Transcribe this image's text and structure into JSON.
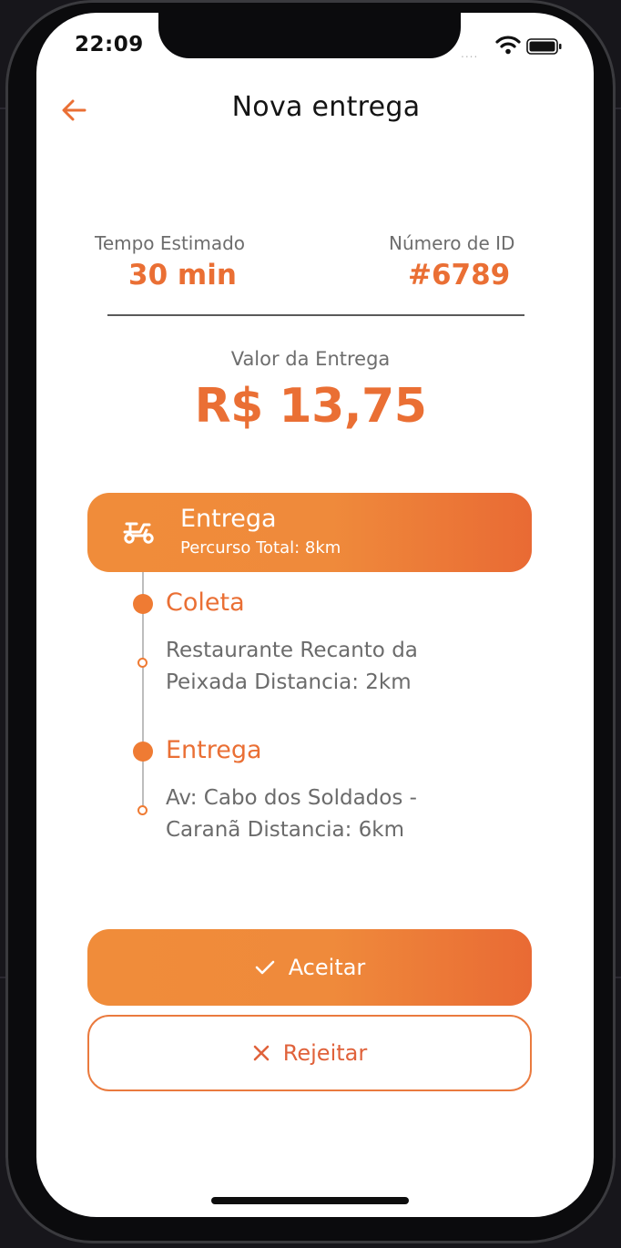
{
  "status_bar": {
    "time": "22:09",
    "signal_dots": "....",
    "wifi_icon": "wifi-icon",
    "battery_icon": "battery-icon"
  },
  "header": {
    "back_icon": "arrow-left-icon",
    "title": "Nova entrega"
  },
  "summary": {
    "eta_label": "Tempo Estimado",
    "eta_value": "30 min",
    "id_label": "Número de ID",
    "id_value": "#6789"
  },
  "delivery_value": {
    "label": "Valor da Entrega",
    "amount": "R$ 13,75"
  },
  "route": {
    "icon": "scooter-icon",
    "title": "Entrega",
    "subtitle": "Percurso Total: 8km",
    "stops": [
      {
        "title": "Coleta",
        "line1": "Restaurante Recanto da",
        "line2": "Peixada Distancia: 2km"
      },
      {
        "title": "Entrega",
        "line1": "Av: Cabo dos Soldados -",
        "line2": "Caranã Distancia: 6km"
      }
    ]
  },
  "actions": {
    "accept_label": "Aceitar",
    "accept_icon": "check-icon",
    "reject_label": "Rejeitar",
    "reject_icon": "close-icon"
  },
  "colors": {
    "accent": "#ea6f34",
    "gradient_start": "#f08c3a",
    "gradient_end": "#e96a34",
    "muted_text": "#6d6d6d"
  }
}
